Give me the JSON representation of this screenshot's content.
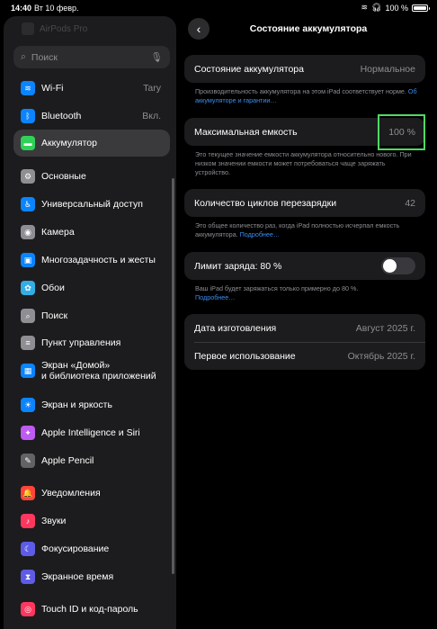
{
  "status_bar": {
    "time": "14:40",
    "date": "Вт 10 февр.",
    "battery_text": "100 %",
    "battery_level": 1.0
  },
  "sidebar": {
    "top_ghost": "AirPods Pro",
    "search_placeholder": "Поиск",
    "items": [
      {
        "label": "Wi-Fi",
        "value": "Tary",
        "icon": "wifi-icon",
        "color": "#0a84ff",
        "glyph": "≋"
      },
      {
        "label": "Bluetooth",
        "value": "Вкл.",
        "icon": "bluetooth-icon",
        "color": "#0a84ff",
        "glyph": "ᛒ"
      },
      {
        "label": "Аккумулятор",
        "value": "",
        "icon": "battery-icon",
        "color": "#30d158",
        "glyph": "▬"
      },
      {
        "label": "Основные",
        "value": "",
        "icon": "gear-icon",
        "color": "#8e8e93",
        "glyph": "⚙"
      },
      {
        "label": "Универсальный доступ",
        "value": "",
        "icon": "accessibility-icon",
        "color": "#0a84ff",
        "glyph": "♿"
      },
      {
        "label": "Камера",
        "value": "",
        "icon": "camera-icon",
        "color": "#8e8e93",
        "glyph": "◉"
      },
      {
        "label": "Многозадачность и жесты",
        "value": "",
        "icon": "multitasking-icon",
        "color": "#0a84ff",
        "glyph": "▣"
      },
      {
        "label": "Обои",
        "value": "",
        "icon": "wallpaper-icon",
        "color": "#32ade6",
        "glyph": "✿"
      },
      {
        "label": "Поиск",
        "value": "",
        "icon": "search-icon",
        "color": "#8e8e93",
        "glyph": "⌕"
      },
      {
        "label": "Пункт управления",
        "value": "",
        "icon": "control-center-icon",
        "color": "#8e8e93",
        "glyph": "≡"
      },
      {
        "label": "Экран «Домой»",
        "label2": "и библиотека приложений",
        "value": "",
        "icon": "home-screen-icon",
        "color": "#0a84ff",
        "glyph": "▦"
      },
      {
        "label": "Экран и яркость",
        "value": "",
        "icon": "brightness-icon",
        "color": "#0a84ff",
        "glyph": "☀"
      },
      {
        "label": "Apple Intelligence и Siri",
        "value": "",
        "icon": "siri-icon",
        "color": "#bf5af2",
        "glyph": "✦"
      },
      {
        "label": "Apple Pencil",
        "value": "",
        "icon": "pencil-icon",
        "color": "#636366",
        "glyph": "✎"
      },
      {
        "label": "Уведомления",
        "value": "",
        "icon": "notifications-icon",
        "color": "#ff453a",
        "glyph": "🔔"
      },
      {
        "label": "Звуки",
        "value": "",
        "icon": "sounds-icon",
        "color": "#ff375f",
        "glyph": "♪"
      },
      {
        "label": "Фокусирование",
        "value": "",
        "icon": "focus-icon",
        "color": "#5e5ce6",
        "glyph": "☾"
      },
      {
        "label": "Экранное время",
        "value": "",
        "icon": "screen-time-icon",
        "color": "#5e5ce6",
        "glyph": "⧗"
      },
      {
        "label": "Touch ID и код-пароль",
        "value": "",
        "icon": "touch-id-icon",
        "color": "#ff375f",
        "glyph": "◎"
      }
    ]
  },
  "detail": {
    "title": "Состояние аккумулятора",
    "state": {
      "label": "Состояние аккумулятора",
      "value": "Нормальное",
      "footer": "Производительность аккумулятора на этом iPad соответствует норме.",
      "footer_link": "Об аккумуляторе и гарантии…"
    },
    "capacity": {
      "label": "Максимальная емкость",
      "value": "100 %",
      "footer": "Это текущее значение емкости аккумулятора относительно нового. При низком значении емкости может потребоваться чаще заряжать устройство."
    },
    "cycles": {
      "label": "Количество циклов перезарядки",
      "value": "42",
      "footer": "Это общее количество раз, когда iPad полностью исчерпал емкость аккумулятора.",
      "footer_link": "Подробнее…"
    },
    "limit": {
      "label": "Лимит заряда: 80 %",
      "enabled": false,
      "footer": "Ваш iPad будет заряжаться только примерно до 80 %.",
      "footer_link": "Подробнее…"
    },
    "dates": {
      "manufacture_label": "Дата изготовления",
      "manufacture_value": "Август 2025 г.",
      "first_use_label": "Первое использование",
      "first_use_value": "Октябрь 2025 г."
    }
  }
}
